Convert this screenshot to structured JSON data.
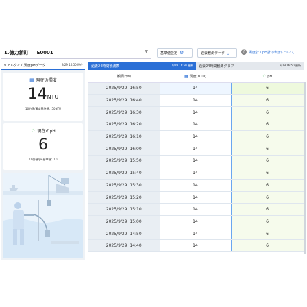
{
  "header": {
    "station_name": "1.徳力新町",
    "station_code": "E0001",
    "standard_button": "基準値設定",
    "past_data_button": "過去観測データ",
    "help_link": "濁度計・pH計の表示について"
  },
  "left_panel": {
    "title": "リアルタイム濁度pHデータ",
    "timestamp": "9/29 16:50 現在",
    "turbidity": {
      "label": "現在の濁度",
      "value": "14",
      "unit": "NTU",
      "standard": "10分値/濁度基準値：50NTU"
    },
    "ph": {
      "label": "現在のpH",
      "value": "6",
      "standard": "10分値/pH基準値：10"
    }
  },
  "right_panel": {
    "tabs": [
      {
        "label": "過去24時間観測表",
        "timestamp": "9/29 16:50 更新",
        "active": true
      },
      {
        "label": "過去24時間観測グラフ",
        "timestamp": "9/29 16:50 更新",
        "active": false
      }
    ],
    "table": {
      "headers": [
        "観測日時",
        "濁度(NTU)",
        "pH"
      ],
      "rows": [
        [
          "2025/9/29",
          "16:50",
          "14",
          "6"
        ],
        [
          "2025/9/29",
          "16:40",
          "14",
          "6"
        ],
        [
          "2025/9/29",
          "16:30",
          "14",
          "6"
        ],
        [
          "2025/9/29",
          "16:20",
          "14",
          "6"
        ],
        [
          "2025/9/29",
          "16:10",
          "14",
          "6"
        ],
        [
          "2025/9/29",
          "16:00",
          "14",
          "6"
        ],
        [
          "2025/9/29",
          "15:50",
          "14",
          "6"
        ],
        [
          "2025/9/29",
          "15:40",
          "14",
          "6"
        ],
        [
          "2025/9/29",
          "15:30",
          "14",
          "6"
        ],
        [
          "2025/9/29",
          "15:20",
          "14",
          "6"
        ],
        [
          "2025/9/29",
          "15:10",
          "14",
          "6"
        ],
        [
          "2025/9/29",
          "15:00",
          "14",
          "6"
        ],
        [
          "2025/9/29",
          "14:50",
          "14",
          "6"
        ],
        [
          "2025/9/29",
          "14:40",
          "14",
          "6"
        ]
      ]
    }
  },
  "colors": {
    "accent": "#2a6fd6",
    "ph_green": "#39b54a",
    "turbidity_column_border": "#6aa6f0",
    "ph_column_bg": "#f6fbec"
  },
  "icons": [
    "chevron-down-icon",
    "gear-icon",
    "download-icon",
    "help-icon",
    "building-icon",
    "drop-icon"
  ]
}
